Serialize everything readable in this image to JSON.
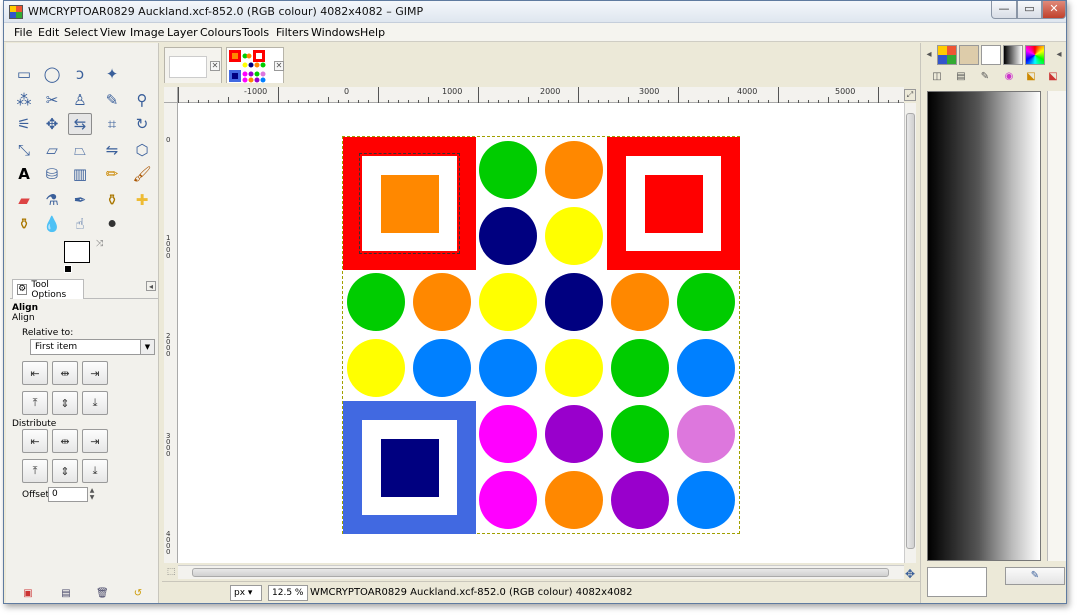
{
  "window": {
    "title": "WMCRYPTOAR0829 Auckland.xcf-852.0 (RGB colour) 4082x4082 – GIMP",
    "minimize_icon": "minimize-icon",
    "maximize_icon": "maximize-icon",
    "close_icon": "close-icon"
  },
  "menu": [
    "File",
    "Edit",
    "Select",
    "View",
    "Image",
    "Layer",
    "Colours",
    "Tools",
    "Filters",
    "Windows",
    "Help"
  ],
  "tool_options": {
    "tab_label": "Tool Options",
    "tool_name": "Align",
    "section_align": "Align",
    "relative_to_label": "Relative to:",
    "relative_to_value": "First item",
    "distribute_label": "Distribute",
    "offset_label": "Offset:",
    "offset_value": "0"
  },
  "rulers": {
    "h_labels": [
      "-1000",
      "0",
      "1000",
      "2000",
      "3000",
      "4000",
      "5000"
    ],
    "v_labels": [
      "0",
      "1000",
      "2000",
      "3000",
      "4000"
    ]
  },
  "status": {
    "unit": "px",
    "zoom": "12.5 %",
    "text": "WMCRYPTOAR0829 Auckland.xcf-852.0 (RGB colour) 4082x4082"
  },
  "colors": {
    "red": "#ff0000",
    "green": "#00cc00",
    "orange": "#ff8800",
    "navy": "#000080",
    "yellow": "#ffff00",
    "blue": "#0080ff",
    "magenta": "#ff00ff",
    "purple": "#9900cc",
    "pink": "#dd77dd",
    "royal": "#4169e1"
  },
  "image_grid": [
    [
      "frame-red-orange",
      "green",
      "orange",
      "frame-red-red"
    ],
    [
      "navy",
      "yellow"
    ],
    [
      "green",
      "orange",
      "yellow",
      "navy",
      "orange",
      "green"
    ],
    [
      "yellow",
      "blue",
      "blue",
      "yellow",
      "green",
      "blue"
    ],
    [
      "frame-blue-navy",
      "magenta",
      "purple",
      "green",
      "pink"
    ],
    [
      "magenta",
      "orange",
      "purple",
      "blue"
    ]
  ]
}
